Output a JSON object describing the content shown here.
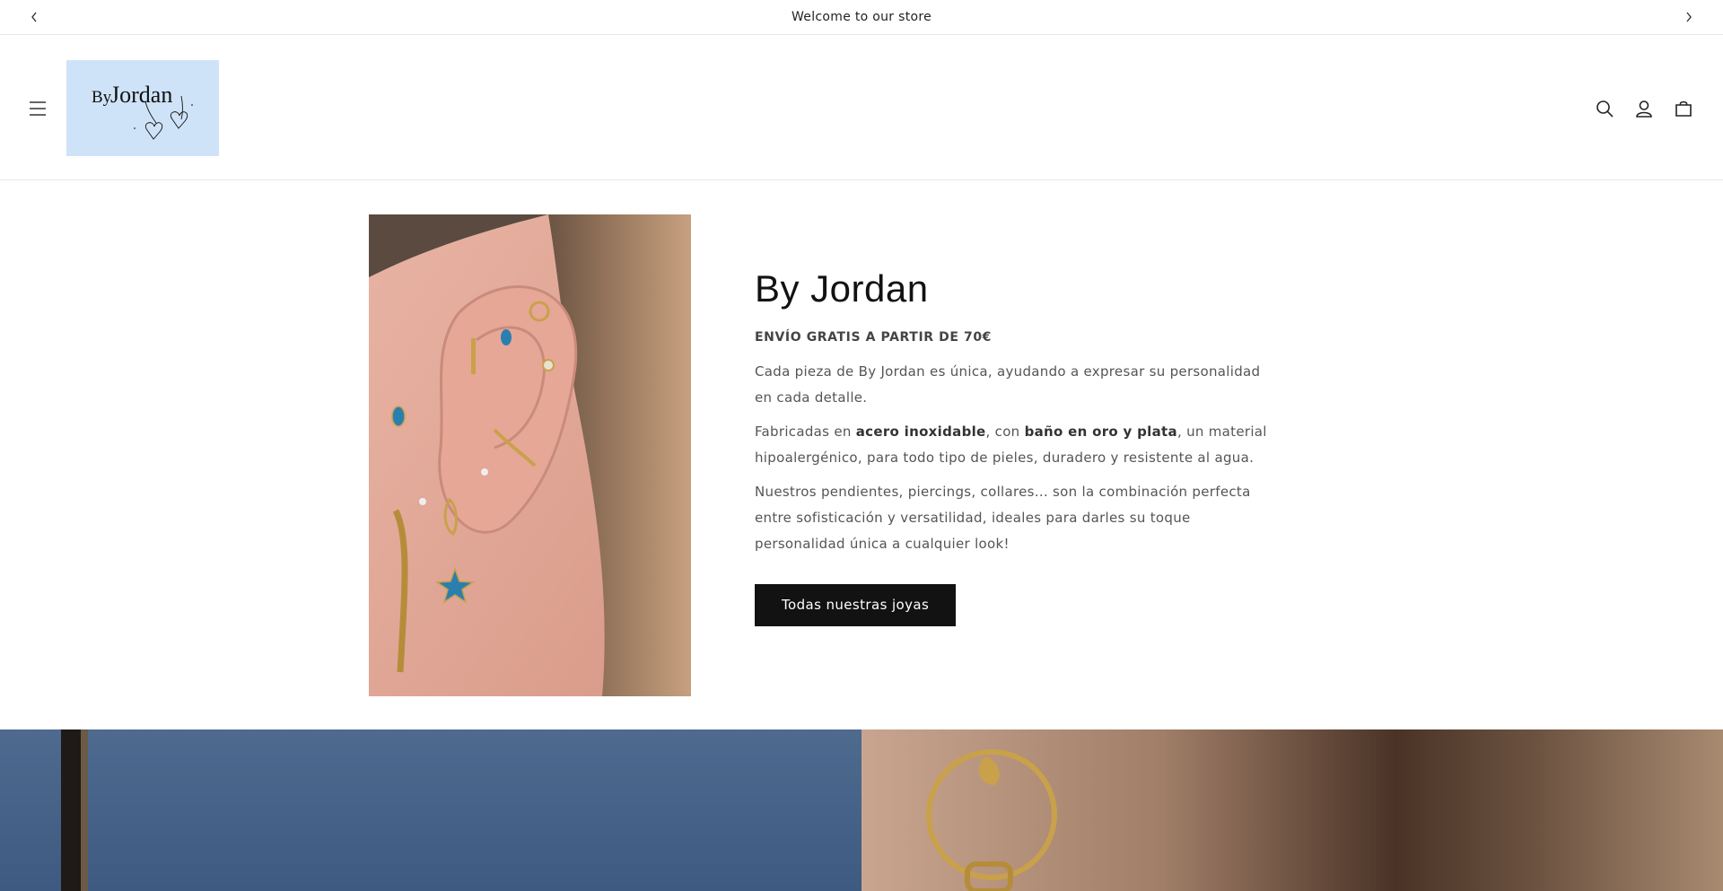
{
  "announcement": {
    "message": "Welcome to our store"
  },
  "header": {
    "logo_text_by": "By",
    "logo_text_name": "Jordan"
  },
  "hero": {
    "title": "By Jordan",
    "subtitle": "ENVÍO GRATIS A PARTIR DE 70€",
    "paragraph1": "Cada pieza de By Jordan es única, ayudando a expresar su personalidad en cada detalle.",
    "paragraph2": {
      "part1": "Fabricadas en ",
      "bold1": "acero inoxidable",
      "part2": ", con ",
      "bold2": "baño en oro y plata",
      "part3": ", un material hipoalergénico, para todo tipo de pieles, duradero y resistente al agua."
    },
    "paragraph3": "Nuestros pendientes, piercings, collares... son la combinación perfecta entre sofisticación y versatilidad, ideales para darles su toque personalidad única a cualquier look!",
    "cta_label": "Todas nuestras joyas"
  },
  "icons": {
    "prev": "chevron-left-icon",
    "next": "chevron-right-icon",
    "menu": "hamburger-menu-icon",
    "search": "search-icon",
    "account": "user-icon",
    "cart": "cart-icon"
  },
  "colors": {
    "logo_bg": "#cfe3f8",
    "button_bg": "#121212",
    "text": "#121212"
  }
}
